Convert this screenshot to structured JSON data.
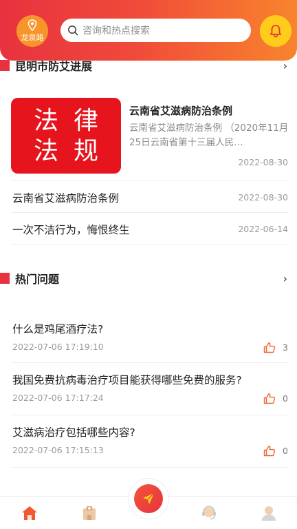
{
  "header": {
    "location": "龙泉路",
    "search_placeholder": "咨询和热点搜索"
  },
  "section_news": {
    "title": "昆明市防艾进展",
    "more": "›"
  },
  "featured_news": {
    "image_lines": [
      [
        "法",
        "律"
      ],
      [
        "法",
        "规"
      ]
    ],
    "title": "云南省艾滋病防治条例",
    "summary": "云南省艾滋病防治条例 （2020年11月25日云南省第十三届人民…",
    "date": "2022-08-30"
  },
  "news_list": [
    {
      "title": "云南省艾滋病防治条例",
      "date": "2022-08-30"
    },
    {
      "title": "一次不洁行为，悔恨终生",
      "date": "2022-06-14"
    }
  ],
  "section_questions": {
    "title": "热门问题",
    "more": "›"
  },
  "questions": [
    {
      "title": "什么是鸡尾酒疗法?",
      "time": "2022-07-06 17:19:10",
      "likes": "3"
    },
    {
      "title": "我国免费抗病毒治疗项目能获得哪些免费的服务?",
      "time": "2022-07-06 17:17:24",
      "likes": "0"
    },
    {
      "title": "艾滋病治疗包括哪些内容?",
      "time": "2022-07-06 17:15:13",
      "likes": "0"
    }
  ],
  "bottom_nav": {
    "items": [
      "home-icon",
      "hospital-icon",
      "send-icon",
      "customer-service-icon",
      "profile-icon"
    ]
  },
  "colors": {
    "brand_red": "#e8323f",
    "brand_orange": "#f7852c",
    "bell_yellow": "#ffcc1a"
  }
}
